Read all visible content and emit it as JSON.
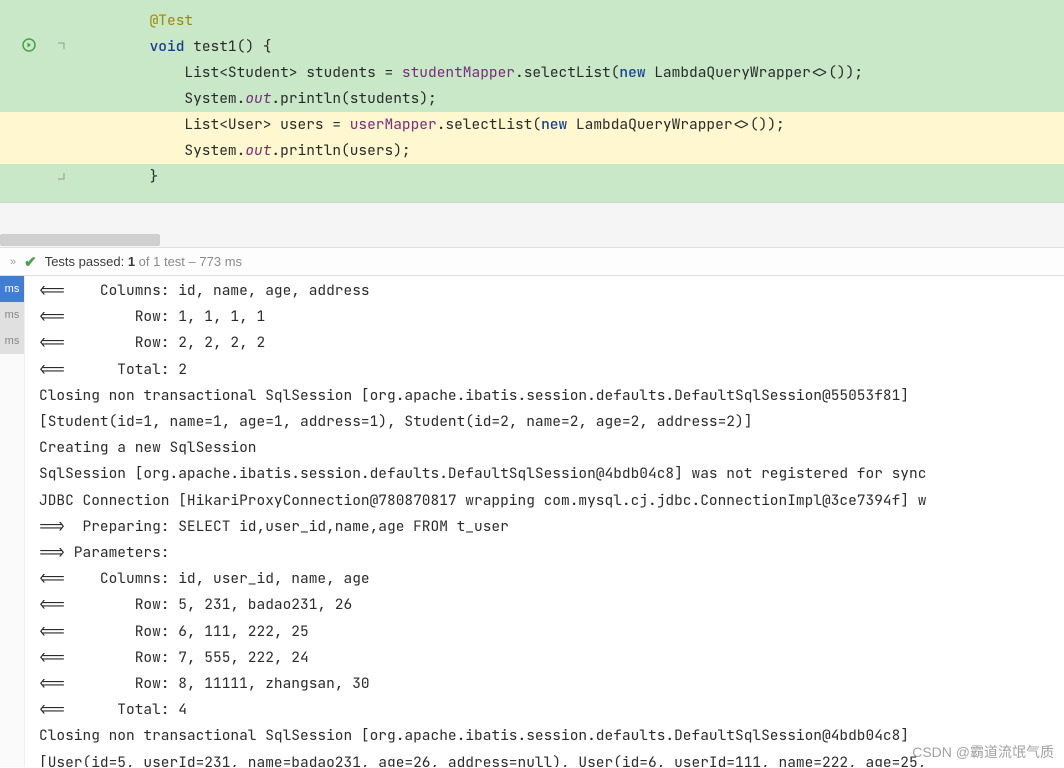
{
  "editor": {
    "line1": {
      "annotation": "@Test"
    },
    "line2": {
      "kw": "void",
      "name": "test1",
      "rest": "() {"
    },
    "line3": {
      "p1": "            List<Student> students = ",
      "mapper": "studentMapper",
      "p2": ".selectList(",
      "nw": "new",
      "p3": " LambdaQueryWrapper<>());"
    },
    "line4": {
      "p1": "            System.",
      "out": "out",
      "p2": ".println(students);"
    },
    "line5": {
      "p1": "            List<User> users = ",
      "mapper": "userMapper",
      "p2": ".selectList(",
      "nw": "new",
      "p3": " LambdaQueryWrapper<>());"
    },
    "line6": {
      "p1": "            System.",
      "out": "out",
      "p2": ".println(users);"
    },
    "line7": {
      "text": "        }"
    }
  },
  "test_status": {
    "prefix": "Tests passed:",
    "count": "1",
    "of": " of 1 test",
    "time": " – 773 ms"
  },
  "gutter_badges": [
    "ms",
    "ms",
    "ms"
  ],
  "console": [
    "<==    Columns: id, name, age, address",
    "<==        Row: 1, 1, 1, 1",
    "<==        Row: 2, 2, 2, 2",
    "<==      Total: 2",
    "Closing non transactional SqlSession [org.apache.ibatis.session.defaults.DefaultSqlSession@55053f81]",
    "[Student(id=1, name=1, age=1, address=1), Student(id=2, name=2, age=2, address=2)]",
    "Creating a new SqlSession",
    "SqlSession [org.apache.ibatis.session.defaults.DefaultSqlSession@4bdb04c8] was not registered for sync",
    "JDBC Connection [HikariProxyConnection@780870817 wrapping com.mysql.cj.jdbc.ConnectionImpl@3ce7394f] w",
    "==>  Preparing: SELECT id,user_id,name,age FROM t_user",
    "==> Parameters:",
    "<==    Columns: id, user_id, name, age",
    "<==        Row: 5, 231, badao231, 26",
    "<==        Row: 6, 111, 222, 25",
    "<==        Row: 7, 555, 222, 24",
    "<==        Row: 8, 11111, zhangsan, 30",
    "<==      Total: 4",
    "Closing non transactional SqlSession [org.apache.ibatis.session.defaults.DefaultSqlSession@4bdb04c8]",
    "[User(id=5, userId=231, name=badao231, age=26, address=null), User(id=6, userId=111, name=222, age=25,"
  ],
  "watermark": "CSDN @霸道流氓气质"
}
